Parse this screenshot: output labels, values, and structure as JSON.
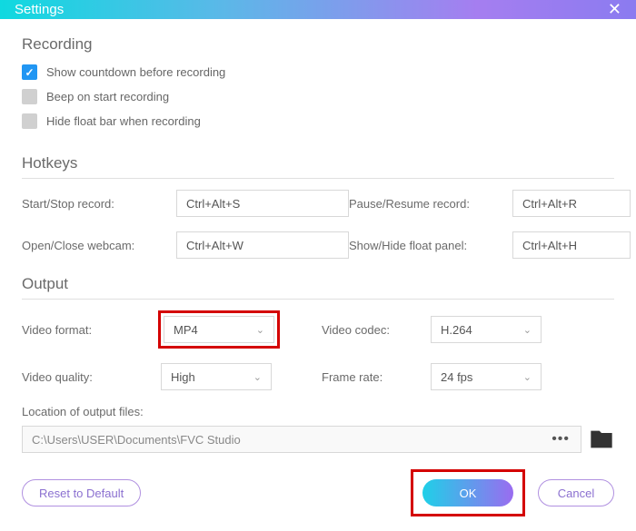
{
  "titlebar": {
    "title": "Settings"
  },
  "recording": {
    "heading": "Recording",
    "opt1": "Show countdown before recording",
    "opt2": "Beep on start recording",
    "opt3": "Hide float bar when recording"
  },
  "hotkeys": {
    "heading": "Hotkeys",
    "r1l": "Start/Stop record:",
    "r1v": "Ctrl+Alt+S",
    "r1rl": "Pause/Resume record:",
    "r1rv": "Ctrl+Alt+R",
    "r2l": "Open/Close webcam:",
    "r2v": "Ctrl+Alt+W",
    "r2rl": "Show/Hide float panel:",
    "r2rv": "Ctrl+Alt+H"
  },
  "output": {
    "heading": "Output",
    "format_label": "Video format:",
    "format_value": "MP4",
    "codec_label": "Video codec:",
    "codec_value": "H.264",
    "quality_label": "Video quality:",
    "quality_value": "High",
    "framerate_label": "Frame rate:",
    "framerate_value": "24 fps",
    "location_label": "Location of output files:",
    "location_value": "C:\\Users\\USER\\Documents\\FVC Studio"
  },
  "footer": {
    "reset": "Reset to Default",
    "ok": "OK",
    "cancel": "Cancel"
  }
}
